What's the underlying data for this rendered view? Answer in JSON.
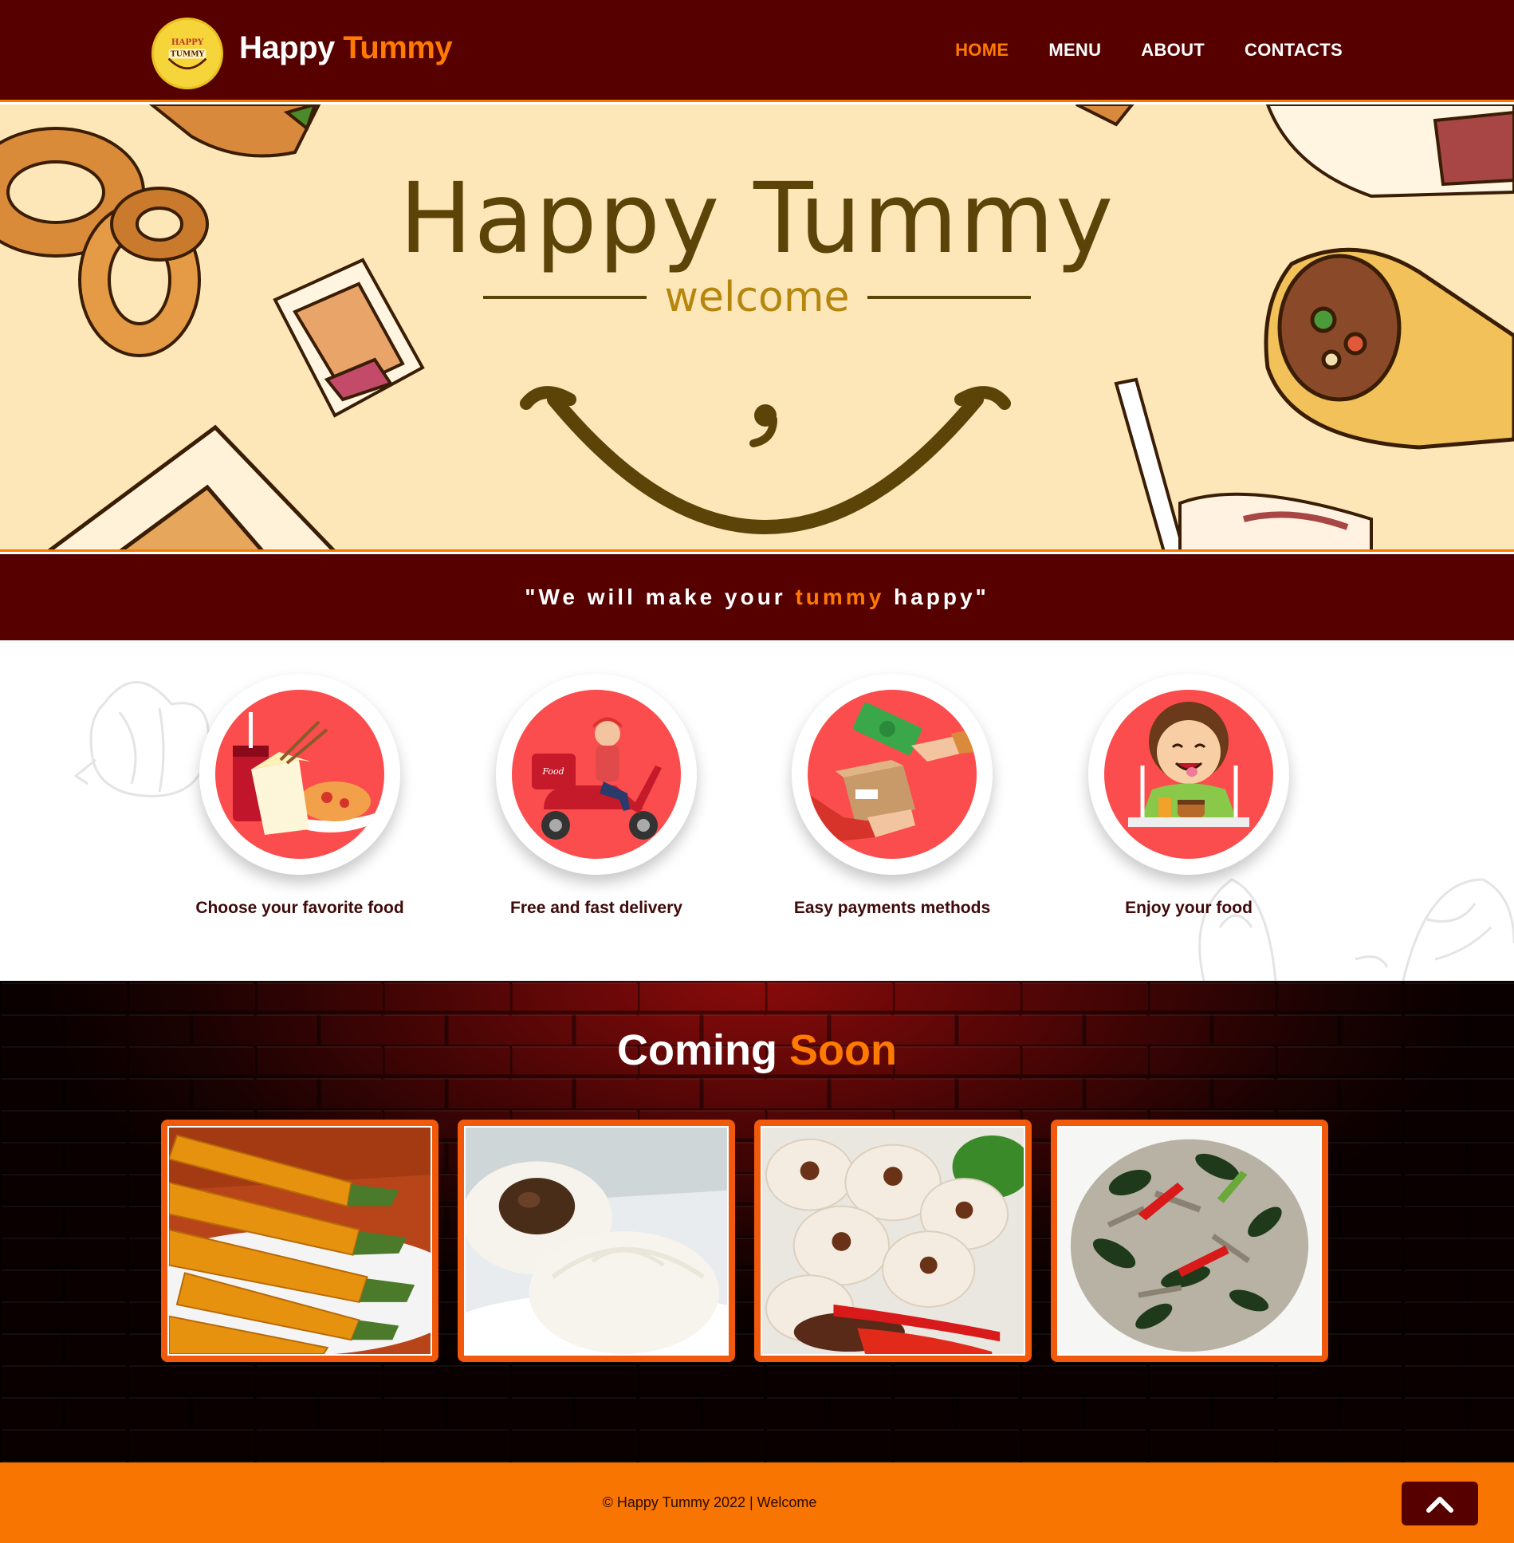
{
  "header": {
    "logo_text_top": "HAPPY",
    "logo_text_bottom": "TUMMY",
    "brand_part1": "Happy",
    "brand_part2": "Tummy",
    "nav": [
      {
        "label": "HOME",
        "active": true
      },
      {
        "label": "MENU",
        "active": false
      },
      {
        "label": "ABOUT",
        "active": false
      },
      {
        "label": "CONTACTS",
        "active": false
      }
    ]
  },
  "hero": {
    "title": "Happy Tummy",
    "subtitle": "welcome"
  },
  "tagline": {
    "open": "\"We will make your ",
    "accent": "tummy",
    "close": " happy\""
  },
  "features": [
    {
      "label": "Choose your favorite food",
      "icon": "food-choice-icon"
    },
    {
      "label": "Free and fast delivery",
      "icon": "delivery-scooter-icon"
    },
    {
      "label": "Easy payments methods",
      "icon": "payment-exchange-icon"
    },
    {
      "label": "Enjoy your food",
      "icon": "happy-eater-icon"
    }
  ],
  "coming_soon": {
    "title_part1": "Coming",
    "title_part2": "Soon",
    "items": [
      "fried-chili-rolls-photo",
      "steamed-buns-photo",
      "siomai-dumplings-photo",
      "vegetable-salad-photo"
    ]
  },
  "footer": {
    "text": "© Happy Tummy 2022 | Welcome",
    "to_top_icon": "chevron-up-icon"
  },
  "colors": {
    "maroon": "#560000",
    "orange": "#ff7a00",
    "hero_bg": "#fde6b7",
    "feature_red": "#fb4d4d",
    "footer_orange": "#f77500"
  }
}
